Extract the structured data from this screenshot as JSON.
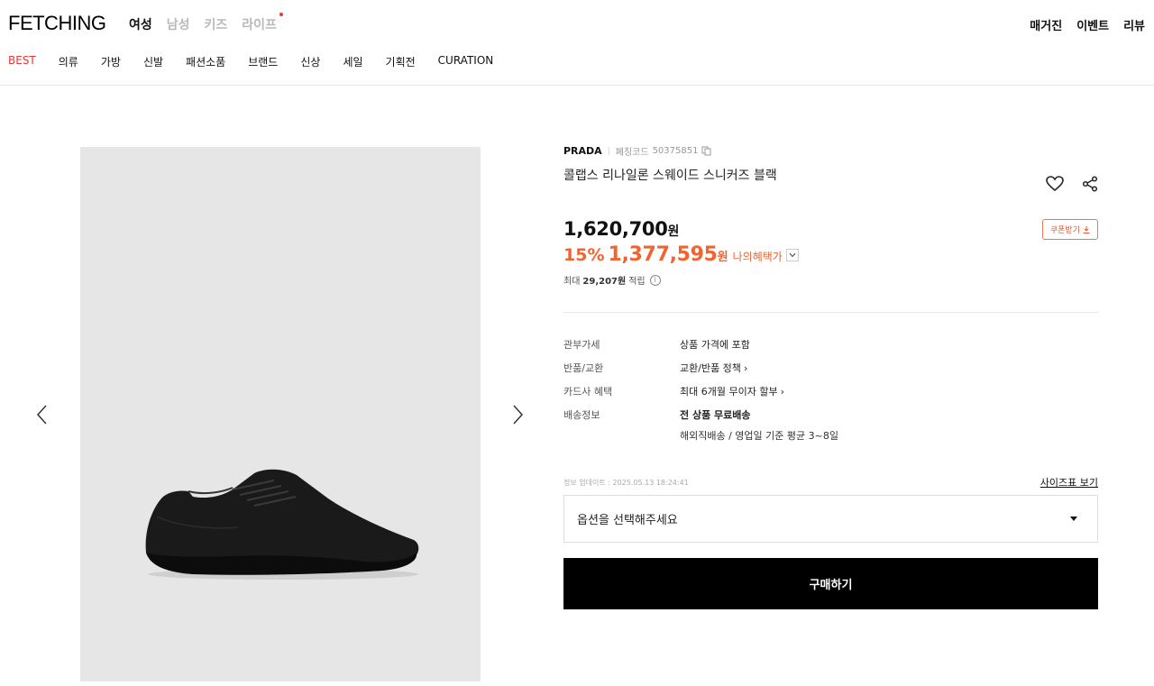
{
  "header": {
    "logo": "FETCHING",
    "gender_tabs": [
      {
        "label": "여성",
        "active": true
      },
      {
        "label": "남성",
        "active": false
      },
      {
        "label": "키즈",
        "active": false
      },
      {
        "label": "라이프",
        "active": false
      }
    ],
    "top_links": [
      "매거진",
      "이벤트",
      "리뷰"
    ],
    "categories": [
      {
        "label": "BEST",
        "active": true
      },
      {
        "label": "의류",
        "active": false
      },
      {
        "label": "가방",
        "active": false
      },
      {
        "label": "신발",
        "active": false
      },
      {
        "label": "패션소품",
        "active": false
      },
      {
        "label": "브랜드",
        "active": false
      },
      {
        "label": "신상",
        "active": false
      },
      {
        "label": "세일",
        "active": false
      },
      {
        "label": "기획전",
        "active": false
      },
      {
        "label": "CURATION",
        "active": false
      }
    ]
  },
  "product": {
    "brand": "PRADA",
    "code_label": "페칭코드",
    "code": "50375851",
    "title": "콜랩스 리나일론 스웨이드 스니커즈 블랙",
    "original_price": "1,620,700",
    "currency": "원",
    "discount_rate": "15%",
    "sale_price": "1,377,595",
    "benefit_label": "나의혜택가",
    "coupon_label": "쿠폰받기",
    "points_prefix": "최대",
    "points_value": "29,207원",
    "points_suffix": "적립"
  },
  "details": [
    {
      "label": "관부가세",
      "value": "상품 가격에 포함",
      "link": false
    },
    {
      "label": "반품/교환",
      "value": "교환/반품 정책",
      "link": true
    },
    {
      "label": "카드사 혜택",
      "value": "최대 6개월 무이자 할부",
      "link": true
    },
    {
      "label": "배송정보",
      "value": "전 상품 무료배송",
      "sub": "해외직배송 / 영업일 기준 평균 3~8일"
    }
  ],
  "update_text": "정보 업데이트 : 2025.05.13 18:24:41",
  "size_chart_label": "사이즈표 보기",
  "option_placeholder": "옵션을 선택해주세요",
  "buy_label": "구매하기",
  "icons": {
    "heart": "heart-icon",
    "share": "share-icon",
    "prev": "chevron-left-icon",
    "next": "chevron-right-icon",
    "copy": "copy-icon",
    "download": "download-icon",
    "info": "info-icon"
  },
  "colors": {
    "accent": "#e53935",
    "sale": "#f1642f",
    "button": "#000000"
  }
}
